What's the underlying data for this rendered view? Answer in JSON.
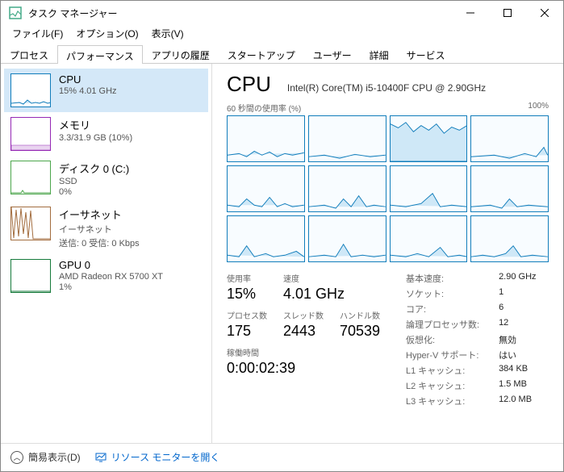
{
  "window": {
    "title": "タスク マネージャー"
  },
  "menu": {
    "file": "ファイル(F)",
    "options": "オプション(O)",
    "view": "表示(V)"
  },
  "tabs": {
    "processes": "プロセス",
    "performance": "パフォーマンス",
    "apphistory": "アプリの履歴",
    "startup": "スタートアップ",
    "users": "ユーザー",
    "details": "詳細",
    "services": "サービス"
  },
  "sidebar": {
    "cpu": {
      "title": "CPU",
      "sub": "15%  4.01 GHz"
    },
    "mem": {
      "title": "メモリ",
      "sub": "3.3/31.9 GB (10%)"
    },
    "disk": {
      "title": "ディスク 0 (C:)",
      "sub1": "SSD",
      "sub2": "0%"
    },
    "net": {
      "title": "イーサネット",
      "sub1": "イーサネット",
      "sub2": "送信: 0  受信: 0 Kbps"
    },
    "gpu": {
      "title": "GPU 0",
      "sub1": "AMD Radeon RX 5700 XT",
      "sub2": "1%"
    }
  },
  "cpu": {
    "title": "CPU",
    "model": "Intel(R) Core(TM) i5-10400F CPU @ 2.90GHz",
    "graph_left": "60 秒間の使用率 (%)",
    "graph_right": "100%",
    "util_label": "使用率",
    "util": "15%",
    "speed_label": "速度",
    "speed": "4.01 GHz",
    "proc_label": "プロセス数",
    "proc": "175",
    "thr_label": "スレッド数",
    "thr": "2443",
    "hnd_label": "ハンドル数",
    "hnd": "70539",
    "uptime_label": "稼働時間",
    "uptime": "0:00:02:39",
    "r": {
      "base_l": "基本速度:",
      "base_v": "2.90 GHz",
      "sock_l": "ソケット:",
      "sock_v": "1",
      "core_l": "コア:",
      "core_v": "6",
      "logi_l": "論理プロセッサ数:",
      "logi_v": "12",
      "virt_l": "仮想化:",
      "virt_v": "無効",
      "hv_l": "Hyper-V サポート:",
      "hv_v": "はい",
      "l1_l": "L1 キャッシュ:",
      "l1_v": "384 KB",
      "l2_l": "L2 キャッシュ:",
      "l2_v": "1.5 MB",
      "l3_l": "L3 キャッシュ:",
      "l3_v": "12.0 MB"
    }
  },
  "footer": {
    "fewer": "簡易表示(D)",
    "resmon": "リソース モニターを開く"
  }
}
